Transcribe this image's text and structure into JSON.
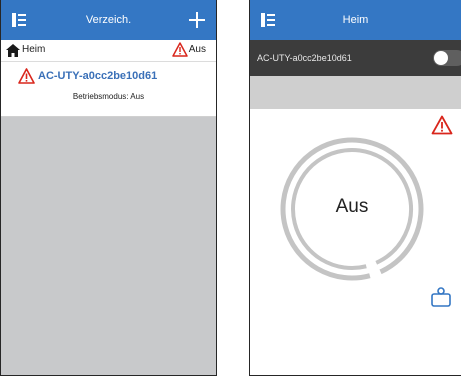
{
  "left_screen": {
    "header": {
      "title": "Verzeich."
    },
    "group": {
      "name": "Heim",
      "state": "Aus"
    },
    "device": {
      "name": "AC-UTY-a0cc2be10d61",
      "mode": "Betriebsmodus: Aus"
    }
  },
  "right_screen": {
    "header": {
      "title": "Heim"
    },
    "device_bar": {
      "name": "AC-UTY-a0cc2be10d61",
      "power_toggle_on": false
    },
    "dial": {
      "state_label": "Aus"
    }
  },
  "colors": {
    "header_bg": "#3477c4",
    "device_bar_bg": "#3c3c3c",
    "warning": "#d9261c",
    "device_name": "#3a70b8",
    "list_bg": "#c8c9cb",
    "dial_ring": "#c4c4c4"
  },
  "icons": [
    "menu-icon",
    "plus-icon",
    "home-icon",
    "warning-icon",
    "remote-control-icon"
  ]
}
